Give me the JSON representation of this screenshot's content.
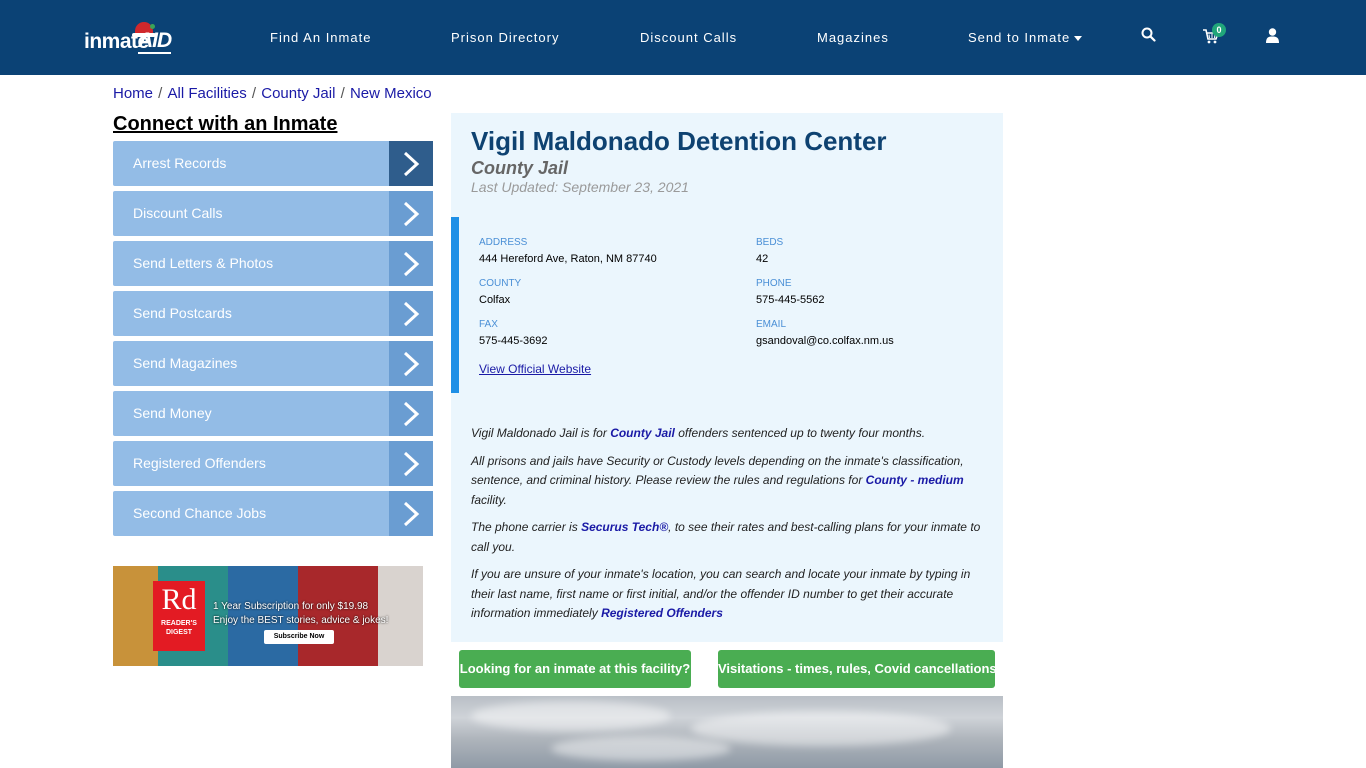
{
  "header": {
    "logo": {
      "text_main": "inmate",
      "text_accent": "AID"
    },
    "nav": [
      {
        "label": "Find An Inmate"
      },
      {
        "label": "Prison Directory"
      },
      {
        "label": "Discount Calls"
      },
      {
        "label": "Magazines"
      },
      {
        "label": "Send to Inmate",
        "has_dropdown": true
      }
    ],
    "icons": {
      "search": "search-icon",
      "cart": "shopping-cart-icon",
      "user": "user-icon"
    },
    "cart_count": "0",
    "colors": {
      "background": "#0b4275",
      "badge": "#21a67a"
    }
  },
  "breadcrumb": [
    {
      "label": "Home"
    },
    {
      "label": "All Facilities"
    },
    {
      "label": "County Jail"
    },
    {
      "label": "New Mexico"
    }
  ],
  "sidebar": {
    "title": "Connect with an Inmate",
    "items": [
      {
        "label": "Arrest Records"
      },
      {
        "label": "Discount Calls"
      },
      {
        "label": "Send Letters & Photos"
      },
      {
        "label": "Send Postcards"
      },
      {
        "label": "Send Magazines"
      },
      {
        "label": "Send Money"
      },
      {
        "label": "Registered Offenders"
      },
      {
        "label": "Second Chance Jobs"
      }
    ],
    "ad": {
      "brand_big": "Rd",
      "brand_small_1": "READER'S",
      "brand_small_2": "DIGEST",
      "line1": "1 Year Subscription for only $19.98",
      "line2": "Enjoy the BEST stories, advice & jokes!",
      "button": "Subscribe Now"
    }
  },
  "facility": {
    "name": "Vigil Maldonado Detention Center",
    "type": "County Jail",
    "last_updated": "Last Updated: September 23, 2021",
    "info": {
      "address": {
        "label": "ADDRESS",
        "value": "444 Hereford Ave, Raton, NM 87740"
      },
      "beds": {
        "label": "BEDS",
        "value": "42"
      },
      "county": {
        "label": "COUNTY",
        "value": "Colfax"
      },
      "phone": {
        "label": "PHONE",
        "value": "575-445-5562"
      },
      "fax": {
        "label": "FAX",
        "value": "575-445-3692"
      },
      "email": {
        "label": "EMAIL",
        "value": "gsandoval@co.colfax.nm.us"
      },
      "website_link": "View Official Website"
    },
    "description": {
      "p1_a": "Vigil Maldonado Jail is for ",
      "p1_link": "County Jail",
      "p1_b": " offenders sentenced up to twenty four months.",
      "p2_a": "All prisons and jails have Security or Custody levels depending on the inmate's classification, sentence, and criminal history. Please review the rules and regulations for ",
      "p2_link": "County - medium",
      "p2_b": " facility.",
      "p3_a": "The phone carrier is ",
      "p3_link": "Securus Tech®",
      "p3_b": ", to see their rates and best-calling plans for your inmate to call you.",
      "p4_a": "If you are unsure of your inmate's location, you can search and locate your inmate by typing in their last name, first name or first initial, and/or the offender ID number to get their accurate information immediately ",
      "p4_link": "Registered Offenders"
    }
  },
  "actions": {
    "find_inmate": "Looking for an inmate at this facility?",
    "visitations": "Visitations - times, rules, Covid cancellations"
  }
}
